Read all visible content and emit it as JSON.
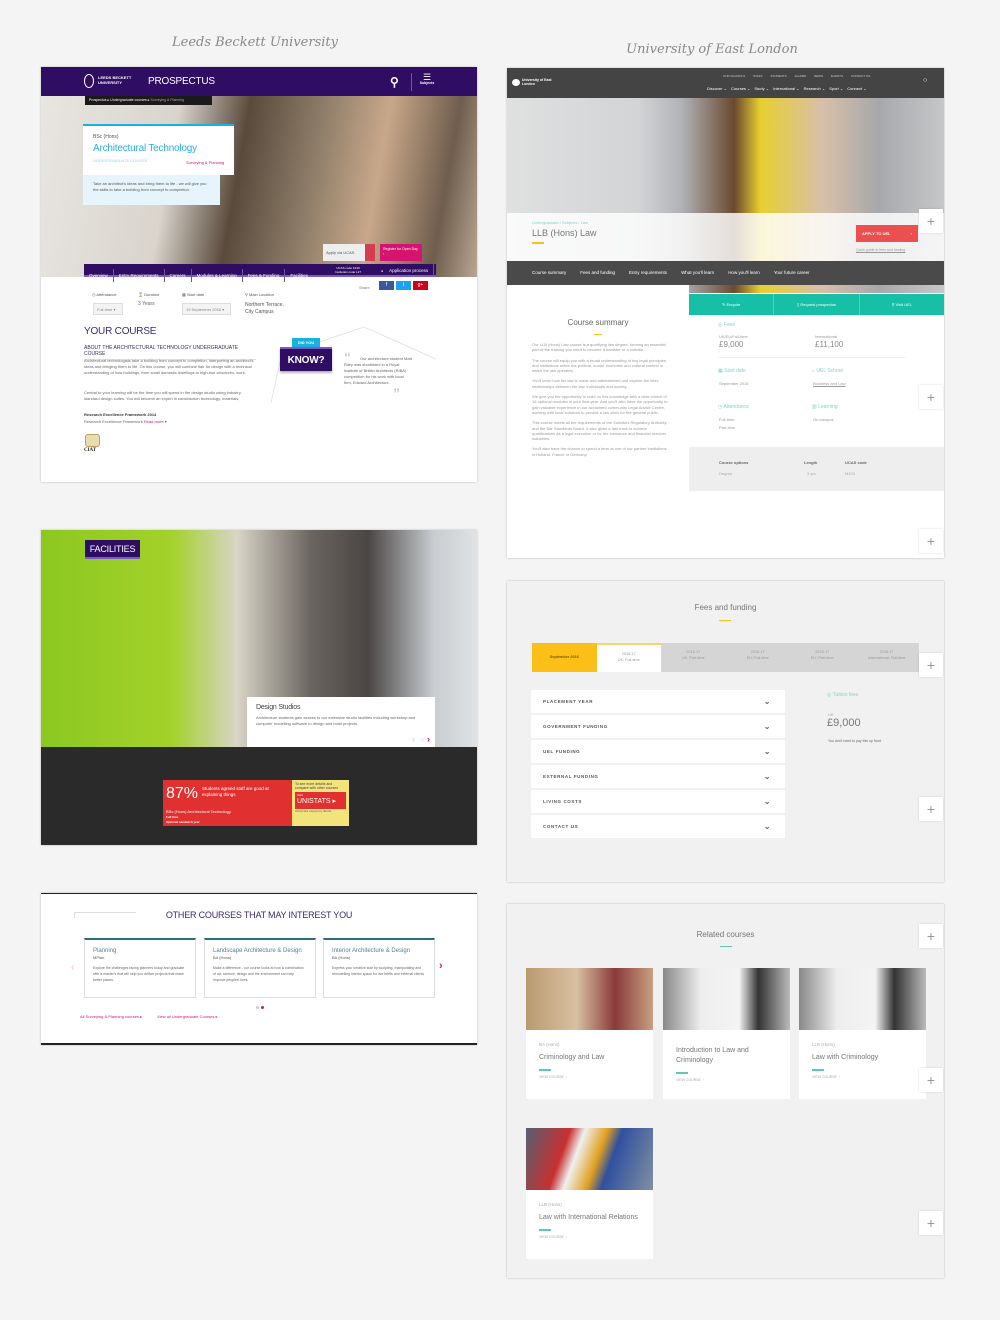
{
  "titles": {
    "left": "Leeds Beckett University",
    "right": "University of East London"
  },
  "lbu": {
    "logo": "LEEDS BECKETT UNIVERSITY",
    "header": "PROSPECTUS",
    "subjects": "Subjects",
    "breadcrumb": [
      "Prospectus",
      "Undergraduate courses",
      "Surveying & Planning"
    ],
    "course_type": "BSc (Hons)",
    "course_title": "Architectural Technology",
    "course_level": "UNDERGRADUATE COURSE",
    "course_subject": "Surveying & Planning",
    "course_intro": "Take an architect's ideas and bring them to life - we will give you the skills to take a building from concept to completion.",
    "apply_ucas": "Apply via UCAS",
    "open_day": "Register for Open Day",
    "nav": [
      "Overview",
      "Entry Requirements",
      "Careers",
      "Modules & Learning",
      "Fees & Funding",
      "Facilities"
    ],
    "ucas_code": "UCAS code K130",
    "institution_code": "Institution code L27",
    "application_process": "Application process",
    "share": "Share",
    "facts": {
      "attendance_label": "Attendance",
      "attendance": "Full-time",
      "duration_label": "Duration",
      "duration": "3 Years",
      "start_label": "Start date",
      "start": "19 September 2016",
      "location_label": "Main Location",
      "location1": "Northern Terrace,",
      "location2": "City Campus"
    },
    "your_course": "YOUR COURSE",
    "about": "ABOUT THE ARCHITECTURAL TECHNOLOGY UNDERGRADUATE COURSE",
    "para1": "Architectural technologists take a building from concept to completion, interpreting an architect's ideas and bringing them to life. On this course, you will combine flair for design with a technical understanding of how buildings, from small domestic dwellings to high-rise structures, work.",
    "para2": "Central to your learning will be the time you will spend in the design studio using industry-standard design suites. You will become an expert in construction technology, materials, legislation and management.",
    "ref_title": "Research Excellence Framework 2014",
    "ref_text": "Research Excellence Framework",
    "read_more": "Read more",
    "ciat": "CIAT",
    "did_you": "DID YOU",
    "know": "KNOW?",
    "quote": "Our architecture student Matt Riley was shortlisted in a Royal Institute of British Architects (RIBA) competition for his work with local firm, Edward Architecture.",
    "facilities": "FACILITIES",
    "studio_title": "Design Studios",
    "studio_text": "Architecture students gain access to our extensive studio facilities including workshop and computer modelling software to design and build projects.",
    "stat_pct": "87%",
    "stat_text": "Students agreed staff are good at explaining things",
    "stat_course": "BSc (Hons) Architectural Technology",
    "stat_mode": "Full time",
    "stat_option": "Optional sandwich year",
    "unistats_text": "To see more details and compare with other courses",
    "visit": "Visit",
    "unistats": "UNISTATS",
    "official": "Official data collected by HEFCE",
    "other_title": "OTHER COURSES THAT MAY INTEREST YOU",
    "other_courses": [
      {
        "title": "Planning",
        "award": "MPlan",
        "desc": "Explore the challenges facing planners today and graduate with a master's that will help you deliver projects that make better places."
      },
      {
        "title": "Landscape Architecture & Design",
        "award": "BA (Hons)",
        "desc": "Make a difference - our course looks at how a combination of art, science, design and the environment can help improve peoples' lives."
      },
      {
        "title": "Interior Architecture & Design",
        "award": "BA (Hons)",
        "desc": "Express your creative side by sculpting, manipulating and remodelling interior space for live briefs and external clients"
      }
    ],
    "link_all": "All Surveying & Planning courses",
    "link_ug": "View all Undergraduate Courses"
  },
  "uel": {
    "logo": "University of East London",
    "top_nav": [
      "OUR SCHOOLS",
      "STAFF",
      "STUDENTS",
      "ALUMNI",
      "NEWS",
      "EVENTS",
      "CONTACT US"
    ],
    "main_nav": [
      "Discover",
      "Courses",
      "Study",
      "International",
      "Research",
      "Sport",
      "Connect"
    ],
    "breadcrumb": "Undergraduate / Subjects / Law",
    "title": "LLB (Hons) Law",
    "apply": "APPLY TO UEL",
    "quick_guide": "Quick guide to fees and funding",
    "tabs": [
      "Course summary",
      "Fees and funding",
      "Entry requirements",
      "What you'll learn",
      "How you'll learn",
      "Your future career"
    ],
    "actions": [
      "Enquire",
      "Request prospectus",
      "Visit UEL"
    ],
    "summary_title": "Course summary",
    "summary": [
      "Our LLB (Hons) Law course is a qualifying law degree, forming an essential part of the training you need to become a barrister or a solicitor.",
      "The course will equip you with a broad understanding of key legal principles and institutions within the political, social, economic and cultural context in which the law operates.",
      "You'll learn how the law is made and administered and explore the inter-relationships between the law, individuals and society.",
      "We give you the opportunity to build on this knowledge with a wide choice of 16 optional modules in your final year. And you'll also have the opportunity to gain valuable experience in our acclaimed community Legal Advice Centre, working with local solicitors to provide a law clinic for the general public.",
      "This course meets all the requirements of the Solicitors Regulatory Authority and the Bar Standards Board. It also gives a fast track to achieve qualifications as a legal executive or for the insurance and financial services industries.",
      "You'll also have the chance to spend a term at one of our partner institutions in Holland, France or Germany."
    ],
    "fees_label": "Fees",
    "uk_label": "UK/EU/Full-time",
    "uk_fee": "£9,000",
    "intl_label": "International",
    "intl_fee": "£11,100",
    "start_label": "Start date",
    "start": "September 2016",
    "school_label": "UEL School",
    "school": "Business and Law",
    "attendance_label": "Attendance",
    "attendance1": "Full-time",
    "attendance2": "Part-time",
    "learning_label": "Learning",
    "learning": "On campus",
    "options_h": [
      "Course options",
      "Length",
      "UCAS code"
    ],
    "options_v": [
      "Degree",
      "3 yrs",
      "M100"
    ],
    "fees_title": "Fees and funding",
    "fee_tabs": [
      {
        "a": "September 2016",
        "b": ""
      },
      {
        "a": "2016-17",
        "b": "UK: Full-time"
      },
      {
        "a": "2016-17",
        "b": "UK: Part-time"
      },
      {
        "a": "2016-17",
        "b": "EU: Full-time"
      },
      {
        "a": "2016-17",
        "b": "EU: Part-time"
      },
      {
        "a": "2016-17",
        "b": "International: Full-time"
      }
    ],
    "accordion": [
      "PLACEMENT YEAR",
      "GOVERNMENT FUNDING",
      "UEL FUNDING",
      "EXTERNAL FUNDING",
      "LIVING COSTS",
      "CONTACT US"
    ],
    "tuition_label": "Tuition fees",
    "tuition_region": "UK",
    "tuition_fee": "£9,000",
    "tuition_note": "You don't need to pay this up front",
    "related_title": "Related courses",
    "related": [
      {
        "deg": "BA (Hons)",
        "name": "Criminology and Law"
      },
      {
        "deg": "",
        "name": "Introduction to Law and Criminology"
      },
      {
        "deg": "LLB (Hons)",
        "name": "Law with Criminology"
      },
      {
        "deg": "LLB (Hons)",
        "name": "Law with International Relations"
      }
    ],
    "view_course": "VIEW COURSE"
  },
  "colors": {
    "lbu_purple": "#2e0d62",
    "lbu_pink": "#d6136f",
    "uel_dark": "#444444",
    "uel_teal": "#17bfa7",
    "uel_yellow": "#fbbf18",
    "uel_red": "#ec4f4f"
  }
}
